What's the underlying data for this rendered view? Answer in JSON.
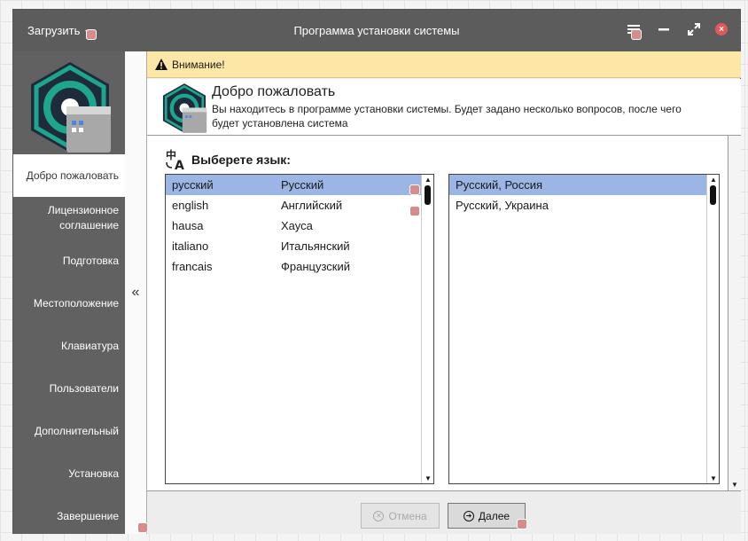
{
  "titlebar": {
    "load_label": "Загрузить",
    "title": "Программа установки системы",
    "icons": [
      "menu-icon",
      "minimize-icon",
      "maximize-icon",
      "close-icon"
    ]
  },
  "sidebar": {
    "items": [
      {
        "label": "Добро пожаловать",
        "active": true
      },
      {
        "label": "Лицензионное соглашение"
      },
      {
        "label": "Подготовка"
      },
      {
        "label": "Местоположение"
      },
      {
        "label": "Клавиатура"
      },
      {
        "label": "Пользователи"
      },
      {
        "label": "Дополнительный"
      },
      {
        "label": "Установка"
      },
      {
        "label": "Завершение"
      }
    ],
    "collapse_glyph": "«"
  },
  "warning": {
    "text": "Внимание!"
  },
  "welcome": {
    "title": "Добро пожаловать",
    "description": "Вы находитесь в программе установки системы. Будет задано несколько вопросов, после чего будет установлена система"
  },
  "language": {
    "label": "Выберете язык:",
    "languages": [
      {
        "native": "русский",
        "name": "Русский",
        "selected": true
      },
      {
        "native": "english",
        "name": "Английский"
      },
      {
        "native": "hausa",
        "name": "Хауса"
      },
      {
        "native": "italiano",
        "name": "Итальянский"
      },
      {
        "native": "francais",
        "name": "Французский"
      }
    ],
    "locales": [
      {
        "name": "Русский, Россия",
        "selected": true
      },
      {
        "name": "Русский, Украина"
      }
    ]
  },
  "footer": {
    "cancel_label": "Отмена",
    "next_label": "Далее"
  },
  "colors": {
    "titlebar": "#5c5c5c",
    "sidebar": "#616161",
    "warning_bg": "#fde7a6",
    "selection": "#9bb5e4",
    "logo_teal": "#1ea58e",
    "logo_dark": "#1d2b3a",
    "close": "#e05a5a"
  }
}
